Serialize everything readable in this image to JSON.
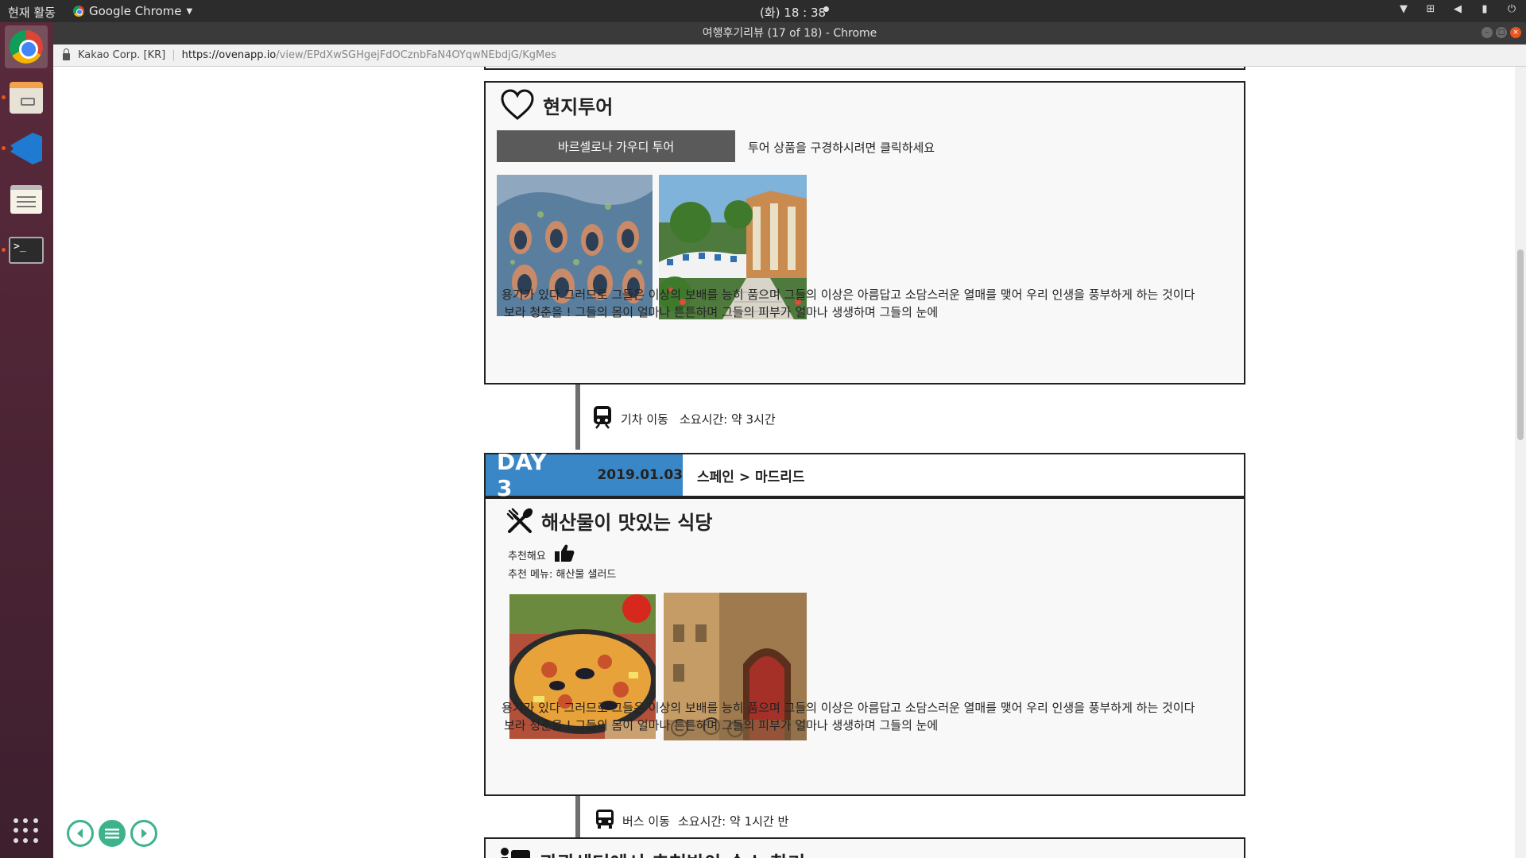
{
  "system_bar": {
    "activities": "현재 활동",
    "app_name": "Google Chrome",
    "clock": "(화) 18 : 38",
    "tray_icons": [
      "chevron-down-icon",
      "network-icon",
      "volume-icon",
      "battery-icon",
      "power-icon"
    ]
  },
  "window": {
    "title": "여행후기리뷰 (17 of 18) - Chrome"
  },
  "launcher": {
    "items": [
      "chrome-icon",
      "files-icon",
      "vscode-icon",
      "text-editor-icon",
      "terminal-icon"
    ],
    "apps_grid": "apps-grid-icon"
  },
  "address_bar": {
    "site_identity": "Kakao Corp. [KR]",
    "url_host": "https://ovenapp.io",
    "url_path": "/view/EPdXwSGHgejFdOCznbFaN4OYqwNEbdjG/KgMes"
  },
  "tour_card": {
    "title": "현지투어",
    "button_label": "바르셀로나 가우디 투어",
    "hint": "투어 상품을 구경하시려면 클릭하세요",
    "photos": [
      "casa-batllo-photo",
      "park-guell-photo"
    ],
    "text_line1": "용기가 있다 그러므로 그들은 이상의 보배를 능히 품으며 그들의 이상은 아름답고 소담스러운 열매를 맺어 우리 인생을 풍부하게 하는 것이다",
    "text_line2": "보라 청춘을 ! 그들의 몸이 얼마나 튼튼하며 그들의 피부가 얼마나 생생하며 그들의 눈에"
  },
  "transfer1": {
    "mode": "기차 이동",
    "duration": "소요시간: 약 3시간"
  },
  "day3": {
    "label": "DAY 3",
    "date": "2019.01.03",
    "route": "스페인 > 마드리드"
  },
  "restaurant_card": {
    "title": "해산물이 맛있는 식당",
    "recommend": "추천해요",
    "menu": "추천 메뉴: 해산물 샐러드",
    "photos": [
      "paella-photo",
      "cafe-street-photo"
    ],
    "text_line1": "용기가 있다 그러므로 그들은 이상의 보배를 능히 품으며 그들의 이상은 아름답고 소담스러운 열매를 맺어 우리 인생을 풍부하게 하는 것이다",
    "text_line2": "보라 청춘을 ! 그들의 몸이 얼마나 튼튼하며 그들의 피부가 얼마나 생생하며 그들의 눈에"
  },
  "transfer2": {
    "mode": "버스 이동",
    "duration": "소요시간: 약 1시간 반"
  },
  "next_card": {
    "title": "관광센터에서 추천받아 숙소 찾기"
  }
}
